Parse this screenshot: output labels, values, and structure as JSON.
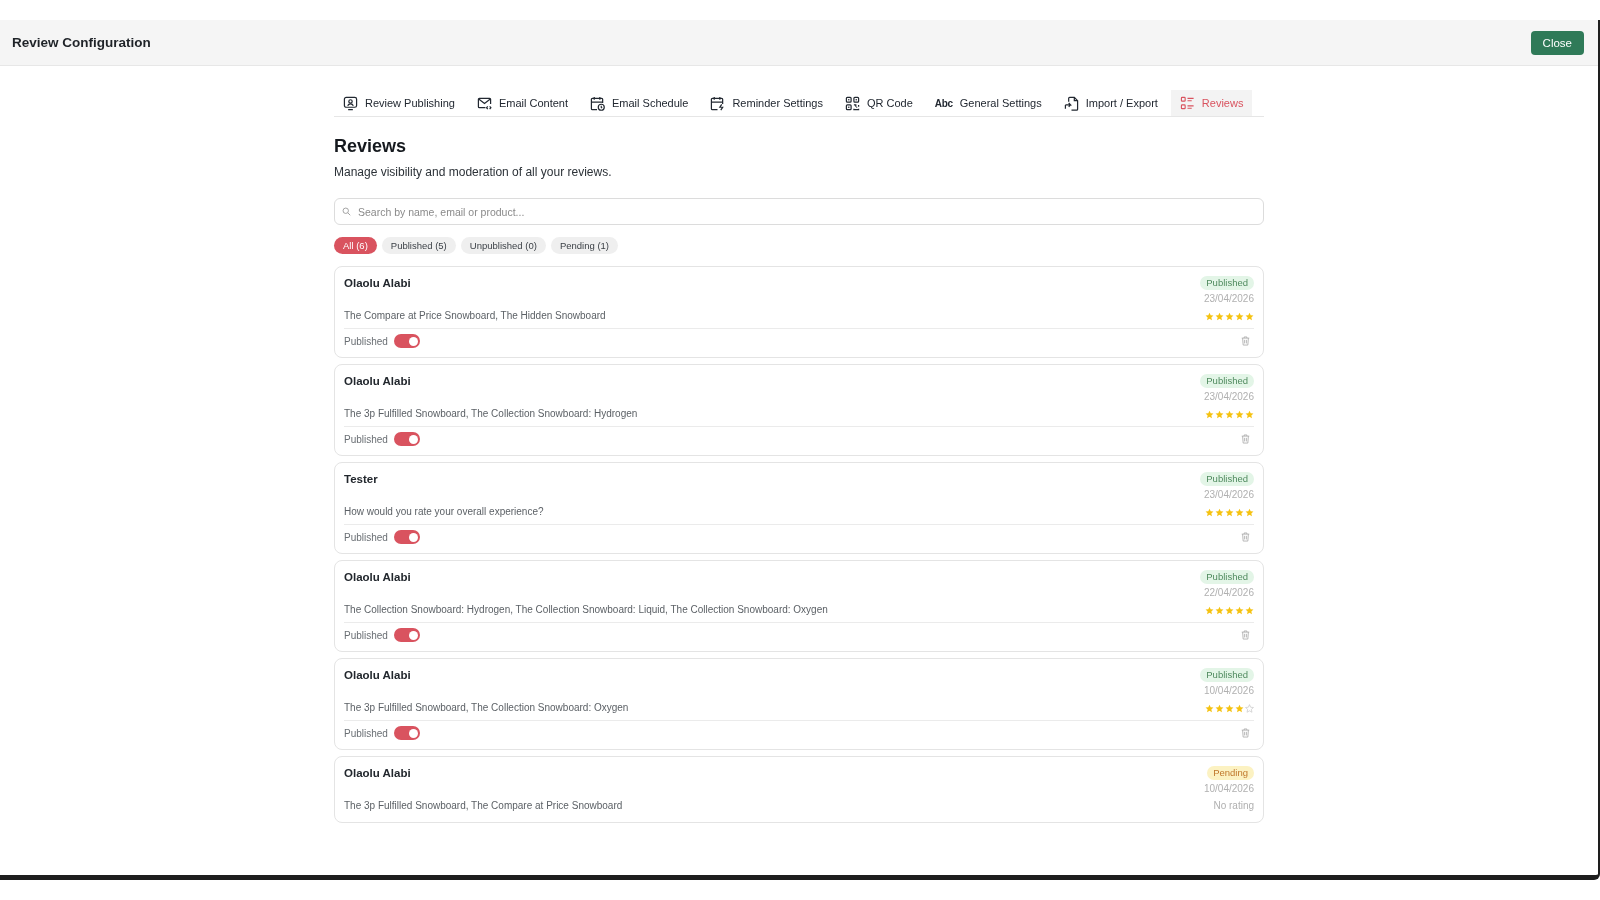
{
  "window": {
    "title": "Review Configuration",
    "close_button": "Close"
  },
  "tabs": [
    {
      "label": "Review Publishing",
      "selected": false
    },
    {
      "label": "Email Content",
      "selected": false
    },
    {
      "label": "Email Schedule",
      "selected": false
    },
    {
      "label": "Reminder Settings",
      "selected": false
    },
    {
      "label": "QR Code",
      "selected": false
    },
    {
      "label": "General Settings",
      "glyph": "Abc",
      "selected": false
    },
    {
      "label": "Import / Export",
      "selected": false
    },
    {
      "label": "Reviews",
      "selected": true
    }
  ],
  "page": {
    "title": "Reviews",
    "subtitle": "Manage visibility and moderation of all your reviews."
  },
  "search": {
    "placeholder": "Search by name, email or product..."
  },
  "filters": [
    {
      "label": "All (6)",
      "selected": true
    },
    {
      "label": "Published (5)",
      "selected": false
    },
    {
      "label": "Unpublished (0)",
      "selected": false
    },
    {
      "label": "Pending (1)",
      "selected": false
    }
  ],
  "reviews": [
    {
      "name": "Olaolu Alabi",
      "status": {
        "label": "Published",
        "kind": "published"
      },
      "date": "23/04/2026",
      "products": "The Compare at Price Snowboard, The Hidden Snowboard",
      "stars": 5,
      "toggle": {
        "label": "Published",
        "on": true
      }
    },
    {
      "name": "Olaolu Alabi",
      "status": {
        "label": "Published",
        "kind": "published"
      },
      "date": "23/04/2026",
      "products": "The 3p Fulfilled Snowboard, The Collection Snowboard: Hydrogen",
      "stars": 5,
      "toggle": {
        "label": "Published",
        "on": true
      }
    },
    {
      "name": "Tester",
      "status": {
        "label": "Published",
        "kind": "published"
      },
      "date": "23/04/2026",
      "products": "How would you rate your overall experience?",
      "stars": 5,
      "toggle": {
        "label": "Published",
        "on": true
      }
    },
    {
      "name": "Olaolu Alabi",
      "status": {
        "label": "Published",
        "kind": "published"
      },
      "date": "22/04/2026",
      "products": "The Collection Snowboard: Hydrogen, The Collection Snowboard: Liquid, The Collection Snowboard: Oxygen",
      "stars": 5,
      "toggle": {
        "label": "Published",
        "on": true
      }
    },
    {
      "name": "Olaolu Alabi",
      "status": {
        "label": "Published",
        "kind": "published"
      },
      "date": "10/04/2026",
      "products": "The 3p Fulfilled Snowboard, The Collection Snowboard: Oxygen",
      "stars": 4,
      "toggle": {
        "label": "Published",
        "on": true
      }
    },
    {
      "name": "Olaolu Alabi",
      "status": {
        "label": "Pending",
        "kind": "pending"
      },
      "date": "10/04/2026",
      "products": "The 3p Fulfilled Snowboard, The Compare at Price Snowboard",
      "rating_text": "No rating"
    }
  ]
}
